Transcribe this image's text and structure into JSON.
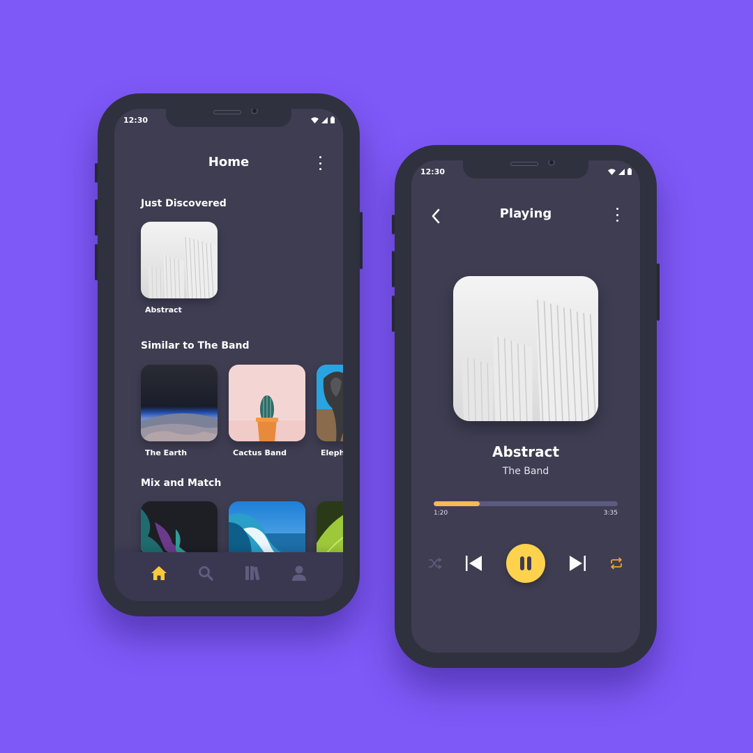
{
  "colors": {
    "background": "#7f59f7",
    "screen": "#3f3d52",
    "accent_yellow": "#ffd24d",
    "progress_fill": "#f7b955",
    "repeat_orange": "#f4a32c"
  },
  "home": {
    "status_time": "12:30",
    "title": "Home",
    "sections": [
      {
        "title": "Just Discovered",
        "items": [
          {
            "label": "Abstract",
            "art": "white-abstract-architecture"
          }
        ]
      },
      {
        "title": "Similar to The Band",
        "items": [
          {
            "label": "The Earth",
            "art": "earth-from-orbit"
          },
          {
            "label": "Cactus Band",
            "art": "cactus-in-pot"
          },
          {
            "label": "Eleph",
            "art": "elephant"
          }
        ]
      },
      {
        "title": "Mix and Match",
        "items": [
          {
            "label": "",
            "art": "dark-paint-texture"
          },
          {
            "label": "",
            "art": "ocean-wave"
          },
          {
            "label": "",
            "art": "green-leaf"
          }
        ]
      }
    ],
    "tabbar": [
      {
        "name": "home-icon",
        "active": true
      },
      {
        "name": "search-icon",
        "active": false
      },
      {
        "name": "library-icon",
        "active": false
      },
      {
        "name": "profile-icon",
        "active": false
      }
    ]
  },
  "player": {
    "status_time": "12:30",
    "title": "Playing",
    "song_title": "Abstract",
    "artist": "The Band",
    "elapsed": "1:20",
    "duration": "3:35",
    "progress": 0.25,
    "controls": [
      "shuffle-icon",
      "previous-icon",
      "pause-icon",
      "next-icon",
      "repeat-icon"
    ]
  }
}
